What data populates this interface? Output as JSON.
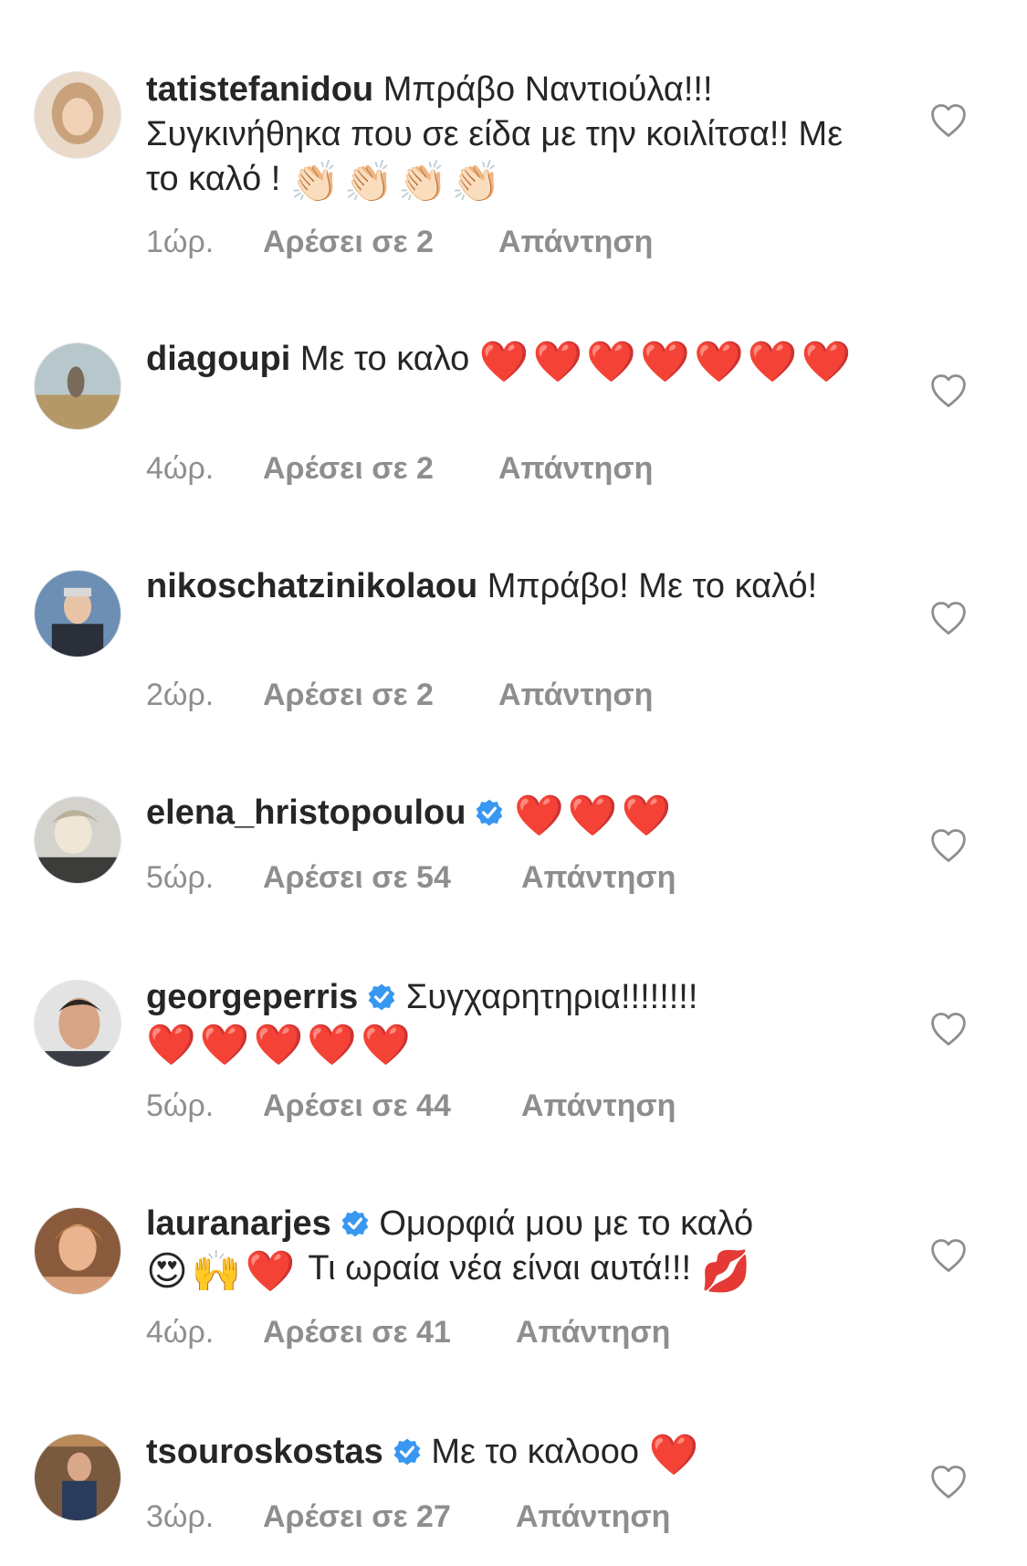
{
  "comments": [
    {
      "username": "tatistefanidou",
      "verified": false,
      "text": "Μπράβο Ναντιούλα!!! Συγκινήθηκα που σε είδα με την κοιλίτσα!! Με το καλό !",
      "emoji": "👏🏻👏🏻👏🏻👏🏻",
      "time": "1ώρ.",
      "likes": "Αρέσει σε 2",
      "reply": "Απάντηση",
      "avatar_color": "#c9a27c"
    },
    {
      "username": "diagoupi",
      "verified": false,
      "text": "Με το καλο",
      "emoji": "❤️❤️❤️❤️❤️❤️❤️",
      "time": "4ώρ.",
      "likes": "Αρέσει σε 2",
      "reply": "Απάντηση",
      "avatar_color": "#a9b6b8"
    },
    {
      "username": "nikoschatzinikolaou",
      "verified": false,
      "text": "Μπράβο! Με το καλό!",
      "emoji": "",
      "time": "2ώρ.",
      "likes": "Αρέσει σε 2",
      "reply": "Απάντηση",
      "avatar_color": "#6d8fb3"
    },
    {
      "username": "elena_hristopoulou",
      "verified": true,
      "text": "",
      "emoji": "❤️❤️❤️",
      "time": "5ώρ.",
      "likes": "Αρέσει σε 54",
      "reply": "Απάντηση",
      "avatar_color": "#8a8a84"
    },
    {
      "username": "georgeperris",
      "verified": true,
      "text": "Συγχαρητηρια!!!!!!!!",
      "emoji": "❤️❤️❤️❤️❤️",
      "time": "5ώρ.",
      "likes": "Αρέσει σε 44",
      "reply": "Απάντηση",
      "avatar_color": "#5a5f66"
    },
    {
      "username": "lauranarjes",
      "verified": true,
      "text": "Ομορφιά μου με το καλό",
      "emoji": "😍🙌❤️",
      "text2": "Τι ωραία νέα είναι αυτά!!!",
      "emoji2": "💋",
      "time": "4ώρ.",
      "likes": "Αρέσει σε 41",
      "reply": "Απάντηση",
      "avatar_color": "#c48a5e"
    },
    {
      "username": "tsouroskostas",
      "verified": true,
      "text": "Με το καλοοο",
      "emoji": "❤️",
      "time": "3ώρ.",
      "likes": "Αρέσει σε 27",
      "reply": "Απάντηση",
      "avatar_color": "#6b4f3a"
    }
  ],
  "icons": {
    "verified": "verified-badge-icon",
    "like": "heart-outline-icon"
  },
  "colors": {
    "verified": "#3897f0",
    "heart": "#ed1c24",
    "meta": "#8e8e8e"
  }
}
